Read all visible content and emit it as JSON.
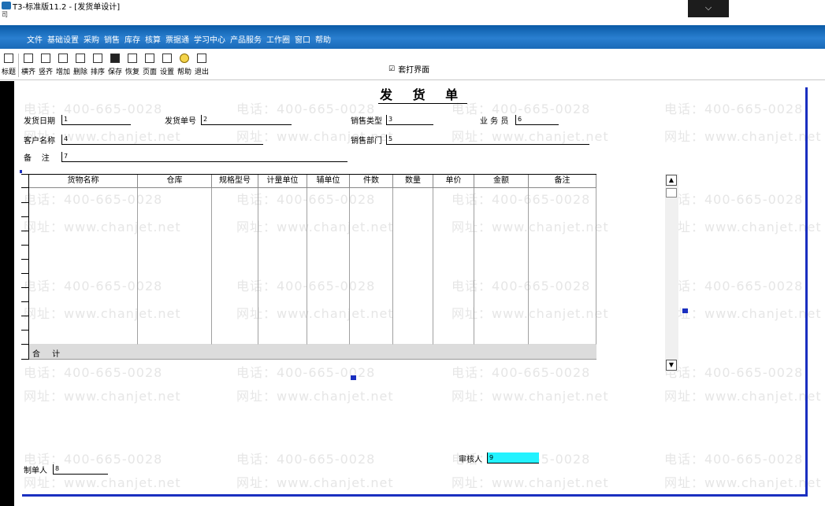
{
  "window": {
    "title": "T3-标准版11.2 - [发货单设计]",
    "sys_mark": "司",
    "collapse_icon": "⌵"
  },
  "menu": [
    "文件",
    "基础设置",
    "采购",
    "销售",
    "库存",
    "核算",
    "票据通",
    "学习中心",
    "产品服务",
    "工作圈",
    "窗口",
    "帮助"
  ],
  "toolbar": {
    "buttons": [
      "标题",
      "横齐",
      "竖齐",
      "增加",
      "删除",
      "排序",
      "保存",
      "恢复",
      "页面",
      "设置",
      "帮助",
      "退出"
    ],
    "print_option": {
      "label": "套打界面",
      "checked_mark": "☑"
    }
  },
  "watermark": {
    "phone": "电话：400-665-0028",
    "site": "网址：www.chanjet.net"
  },
  "form": {
    "title": "发 货 单",
    "fields": {
      "ship_date": {
        "label": "发货日期",
        "value": "1"
      },
      "ship_no": {
        "label": "发货单号",
        "value": "2"
      },
      "sale_type": {
        "label": "销售类型",
        "value": "3"
      },
      "salesman": {
        "label": "业 务 员",
        "value": "6"
      },
      "customer": {
        "label": "客户名称",
        "value": "4"
      },
      "dept": {
        "label": "销售部门",
        "value": "5"
      },
      "remark": {
        "label": "备    注",
        "value": "7"
      },
      "maker": {
        "label": "制单人",
        "value": "8"
      },
      "reviewer": {
        "label": "审核人",
        "value": "9"
      }
    },
    "grid": {
      "headers": [
        "货物名称",
        "仓库",
        "规格型号",
        "计量单位",
        "辅单位",
        "件数",
        "数量",
        "单价",
        "金额",
        "备注"
      ],
      "sum_label": "合 计"
    }
  },
  "scrollbar": {
    "up": "▲",
    "down": "▼"
  }
}
